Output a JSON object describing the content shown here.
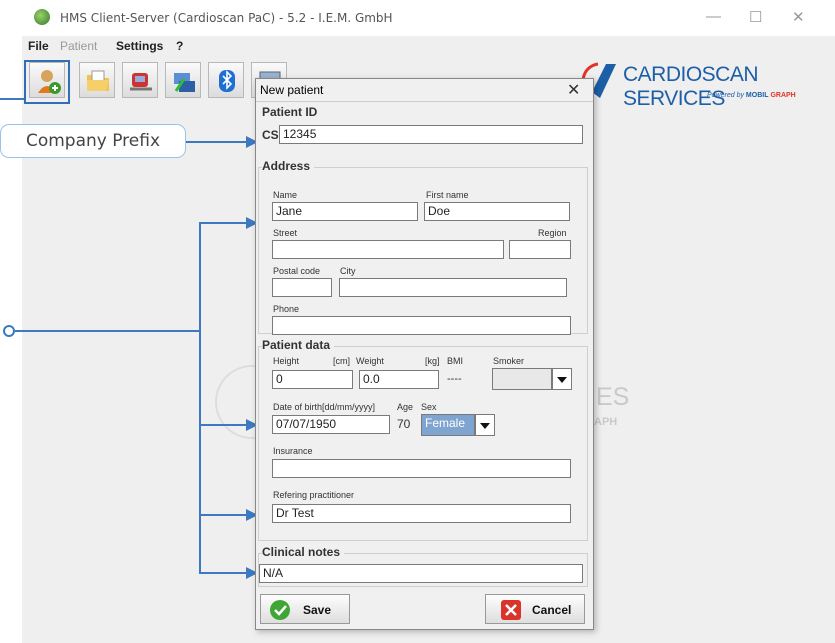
{
  "window": {
    "title": "HMS Client-Server (Cardioscan PaC) - 5.2 - I.E.M. GmbH",
    "minimize": "—",
    "maximize": "☐",
    "close": "✕"
  },
  "menu": {
    "file": "File",
    "patient": "Patient",
    "settings": "Settings",
    "help": "?"
  },
  "toolbar": {
    "buttons": [
      "new-patient-icon",
      "folder-open-icon",
      "device-icon",
      "transfer-icon",
      "bluetooth-icon",
      "window-icon"
    ]
  },
  "logo": {
    "name": "CARDIOSCAN SERVICES",
    "powered": "Powered by",
    "brand_mobil": "MOBIL",
    "brand_graph": "GRAPH"
  },
  "watermark": {
    "partial_text": "ES",
    "partial_sub": "APH"
  },
  "annotation": {
    "company_prefix": "Company Prefix",
    "accent_color": "#3d79c0"
  },
  "dialog": {
    "title": "New patient",
    "close": "✕",
    "patient_id_section": "Patient ID",
    "prefix": "CS",
    "patient_id": "12345",
    "address_section": "Address",
    "name_label": "Name",
    "name_value": "Jane",
    "first_name_label": "First name",
    "first_name_value": "Doe",
    "street_label": "Street",
    "street_value": "",
    "region_label": "Region",
    "region_value": "",
    "postal_label": "Postal code",
    "postal_value": "",
    "city_label": "City",
    "city_value": "",
    "phone_label": "Phone",
    "phone_value": "",
    "patient_data_section": "Patient data",
    "height_label": "Height",
    "height_unit": "[cm]",
    "height_value": "0",
    "weight_label": "Weight",
    "weight_unit": "[kg]",
    "weight_value": "0.0",
    "bmi_label": "BMI",
    "bmi_value": "----",
    "smoker_label": "Smoker",
    "smoker_value": "",
    "dob_label": "Date of birth[dd/mm/yyyy]",
    "dob_value": "07/07/1950",
    "age_label": "Age",
    "age_value": "70",
    "sex_label": "Sex",
    "sex_value": "Female",
    "insurance_label": "Insurance",
    "insurance_value": "",
    "practitioner_label": "Refering practitioner",
    "practitioner_value": "Dr Test",
    "clinical_section": "Clinical notes",
    "clinical_value": "N/A",
    "save": "Save",
    "cancel": "Cancel"
  }
}
